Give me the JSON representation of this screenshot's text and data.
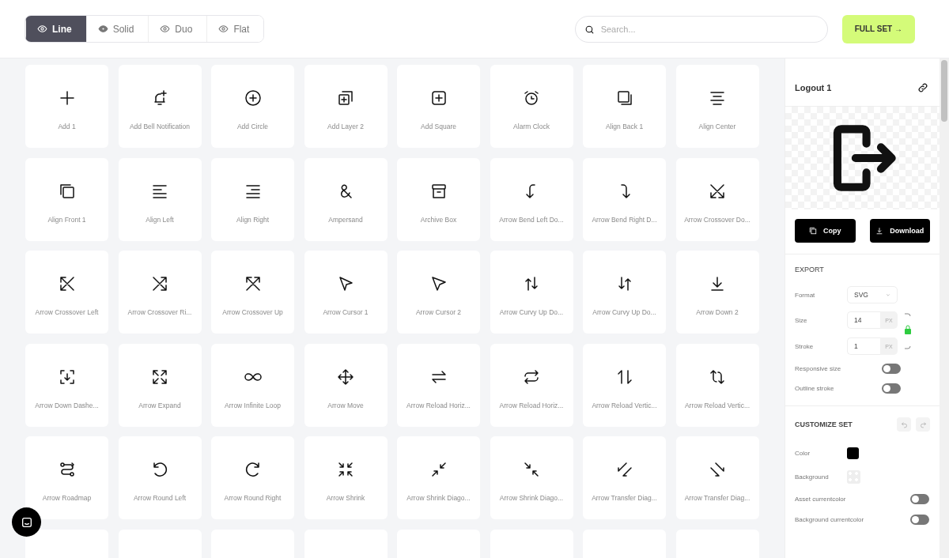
{
  "view_tabs": [
    {
      "label": "Line",
      "selected": true
    },
    {
      "label": "Solid",
      "selected": false
    },
    {
      "label": "Duo",
      "selected": false
    },
    {
      "label": "Flat",
      "selected": false
    }
  ],
  "search": {
    "placeholder": "Search..."
  },
  "full_set_button": "FULL SET →",
  "icons": [
    {
      "label": "Add 1"
    },
    {
      "label": "Add Bell Notification"
    },
    {
      "label": "Add Circle"
    },
    {
      "label": "Add Layer 2"
    },
    {
      "label": "Add Square"
    },
    {
      "label": "Alarm Clock"
    },
    {
      "label": "Align Back 1"
    },
    {
      "label": "Align Center"
    },
    {
      "label": "Align Front 1"
    },
    {
      "label": "Align Left"
    },
    {
      "label": "Align Right"
    },
    {
      "label": "Ampersand"
    },
    {
      "label": "Archive Box"
    },
    {
      "label": "Arrow Bend Left Do..."
    },
    {
      "label": "Arrow Bend Right D..."
    },
    {
      "label": "Arrow Crossover Do..."
    },
    {
      "label": "Arrow Crossover Left"
    },
    {
      "label": "Arrow Crossover Ri..."
    },
    {
      "label": "Arrow Crossover Up"
    },
    {
      "label": "Arrow Cursor 1"
    },
    {
      "label": "Arrow Cursor 2"
    },
    {
      "label": "Arrow Curvy Up Do..."
    },
    {
      "label": "Arrow Curvy Up Do..."
    },
    {
      "label": "Arrow Down 2"
    },
    {
      "label": "Arrow Down Dashe..."
    },
    {
      "label": "Arrow Expand"
    },
    {
      "label": "Arrow Infinite Loop"
    },
    {
      "label": "Arrow Move"
    },
    {
      "label": "Arrow Reload Horiz..."
    },
    {
      "label": "Arrow Reload Horiz..."
    },
    {
      "label": "Arrow Reload Vertic..."
    },
    {
      "label": "Arrow Reload Vertic..."
    },
    {
      "label": "Arrow Roadmap"
    },
    {
      "label": "Arrow Round Left"
    },
    {
      "label": "Arrow Round Right"
    },
    {
      "label": "Arrow Shrink"
    },
    {
      "label": "Arrow Shrink Diago..."
    },
    {
      "label": "Arrow Shrink Diago..."
    },
    {
      "label": "Arrow Transfer Diag..."
    },
    {
      "label": "Arrow Transfer Diag..."
    }
  ],
  "panel": {
    "title": "Logout 1",
    "copy_button": "Copy",
    "download_button": "Download",
    "export": {
      "heading": "EXPORT",
      "format": {
        "label": "Format",
        "value": "SVG"
      },
      "size": {
        "label": "Size",
        "value": "14",
        "unit": "PX"
      },
      "stroke": {
        "label": "Stroke",
        "value": "1",
        "unit": "PX"
      },
      "toggles": [
        {
          "label": "Responsive size",
          "on": false
        },
        {
          "label": "Outline stroke",
          "on": false
        }
      ]
    },
    "customize": {
      "heading": "CUSTOMIZE SET",
      "color": {
        "label": "Color",
        "color": "#000000"
      },
      "background": {
        "label": "Background"
      },
      "toggles": [
        {
          "label": "Asset currentcolor",
          "on": false
        },
        {
          "label": "Background currentcolor",
          "on": false
        }
      ]
    }
  }
}
